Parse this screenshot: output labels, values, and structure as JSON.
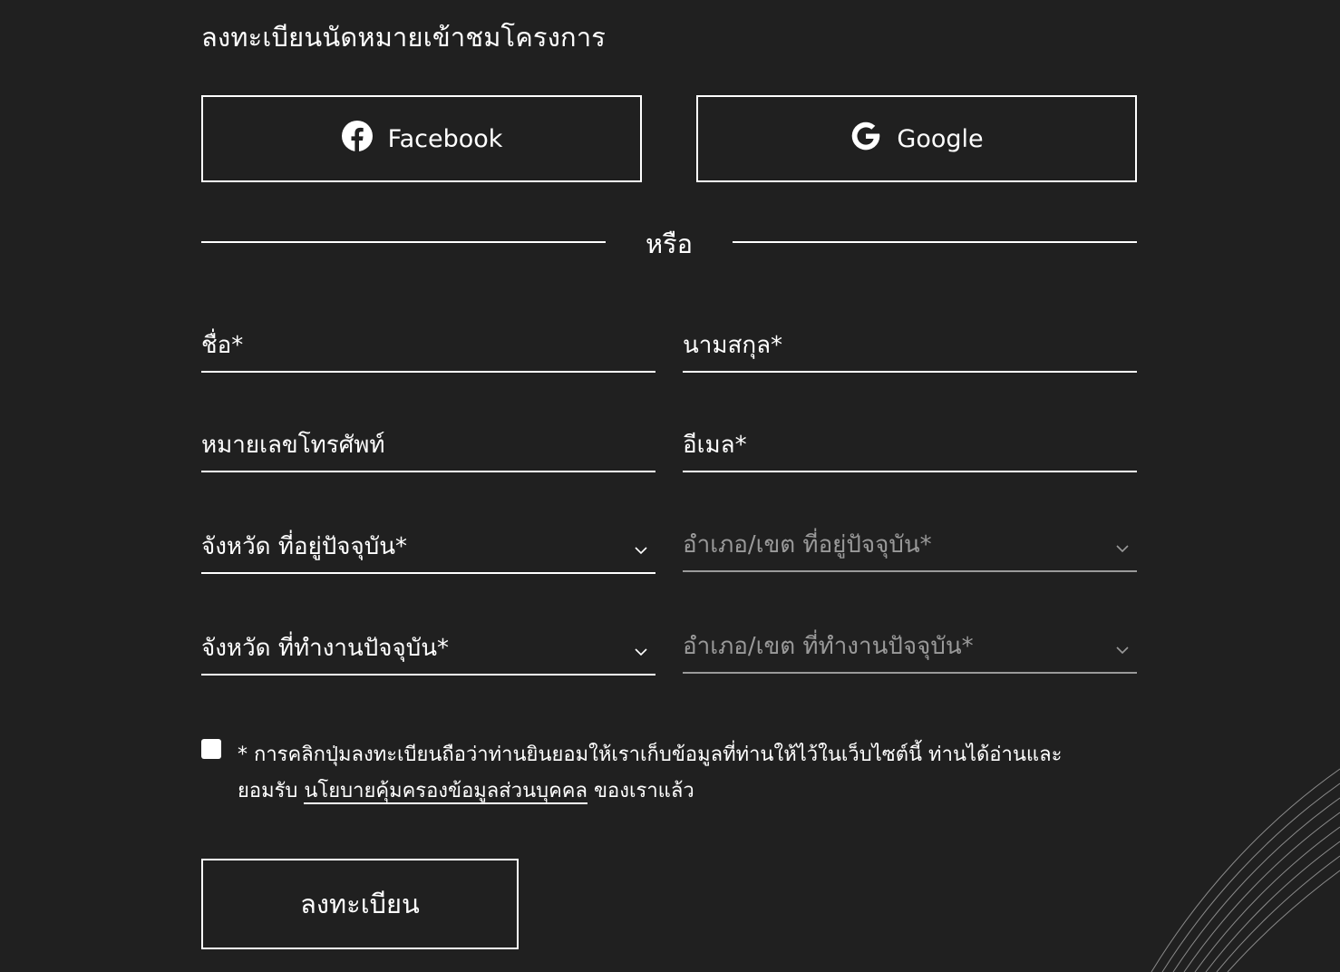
{
  "title": "ลงทะเบียนนัดหมายเข้าชมโครงการ",
  "social": {
    "facebook_label": "Facebook",
    "facebook_icon": "facebook-icon",
    "google_label": "Google",
    "google_icon": "google-icon"
  },
  "divider_text": "หรือ",
  "form": {
    "first_name": "ชื่อ*",
    "last_name": "นามสกุล*",
    "phone": "หมายเลขโทรศัพท์",
    "email": "อีเมล*",
    "home_province": "จังหวัด ที่อยู่ปัจจุบัน*",
    "home_district": "อำเภอ/เขต ที่อยู่ปัจจุบัน*",
    "work_province": "จังหวัด ที่ทำงานปัจจุบัน*",
    "work_district": "อำเภอ/เขต ที่ทำงานปัจจุบัน*"
  },
  "consent": {
    "text_before": "* การคลิกปุ่มลงทะเบียนถือว่าท่านยินยอมให้เราเก็บข้อมูลที่ท่านให้ไว้ในเว็บไซต์นี้ ท่านได้อ่านและยอมรับ ",
    "link": "นโยบายคุ้มครองข้อมูลส่วนบุคคล",
    "text_after": " ของเราแล้ว",
    "checked": false
  },
  "submit_label": "ลงทะเบียน",
  "colors": {
    "background": "#202020",
    "foreground": "#ffffff",
    "disabled": "#9a9a9a"
  }
}
